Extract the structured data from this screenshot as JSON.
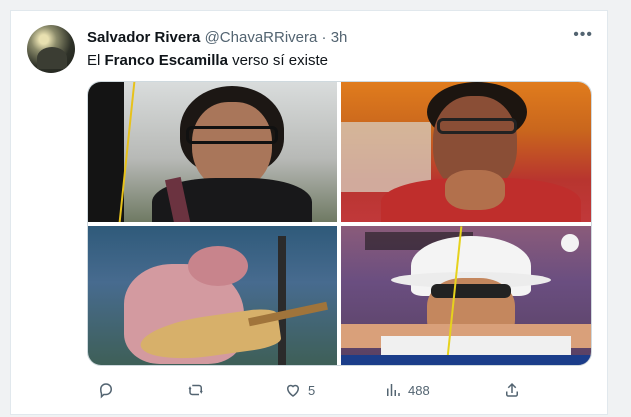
{
  "tweet": {
    "display_name": "Salvador Rivera",
    "handle": "@ChavaRRivera",
    "separator": "·",
    "time": "3h",
    "text_prefix": "El ",
    "text_bold": "Franco Escamilla",
    "text_suffix": " verso sí existe"
  },
  "actions": {
    "likes": "5",
    "views": "488"
  },
  "icons": [
    "reply-icon",
    "retweet-icon",
    "like-icon",
    "views-icon",
    "share-icon",
    "more-icon"
  ],
  "colors": {
    "text": "#0f1419",
    "muted": "#536471",
    "border": "#e1e8ed"
  }
}
